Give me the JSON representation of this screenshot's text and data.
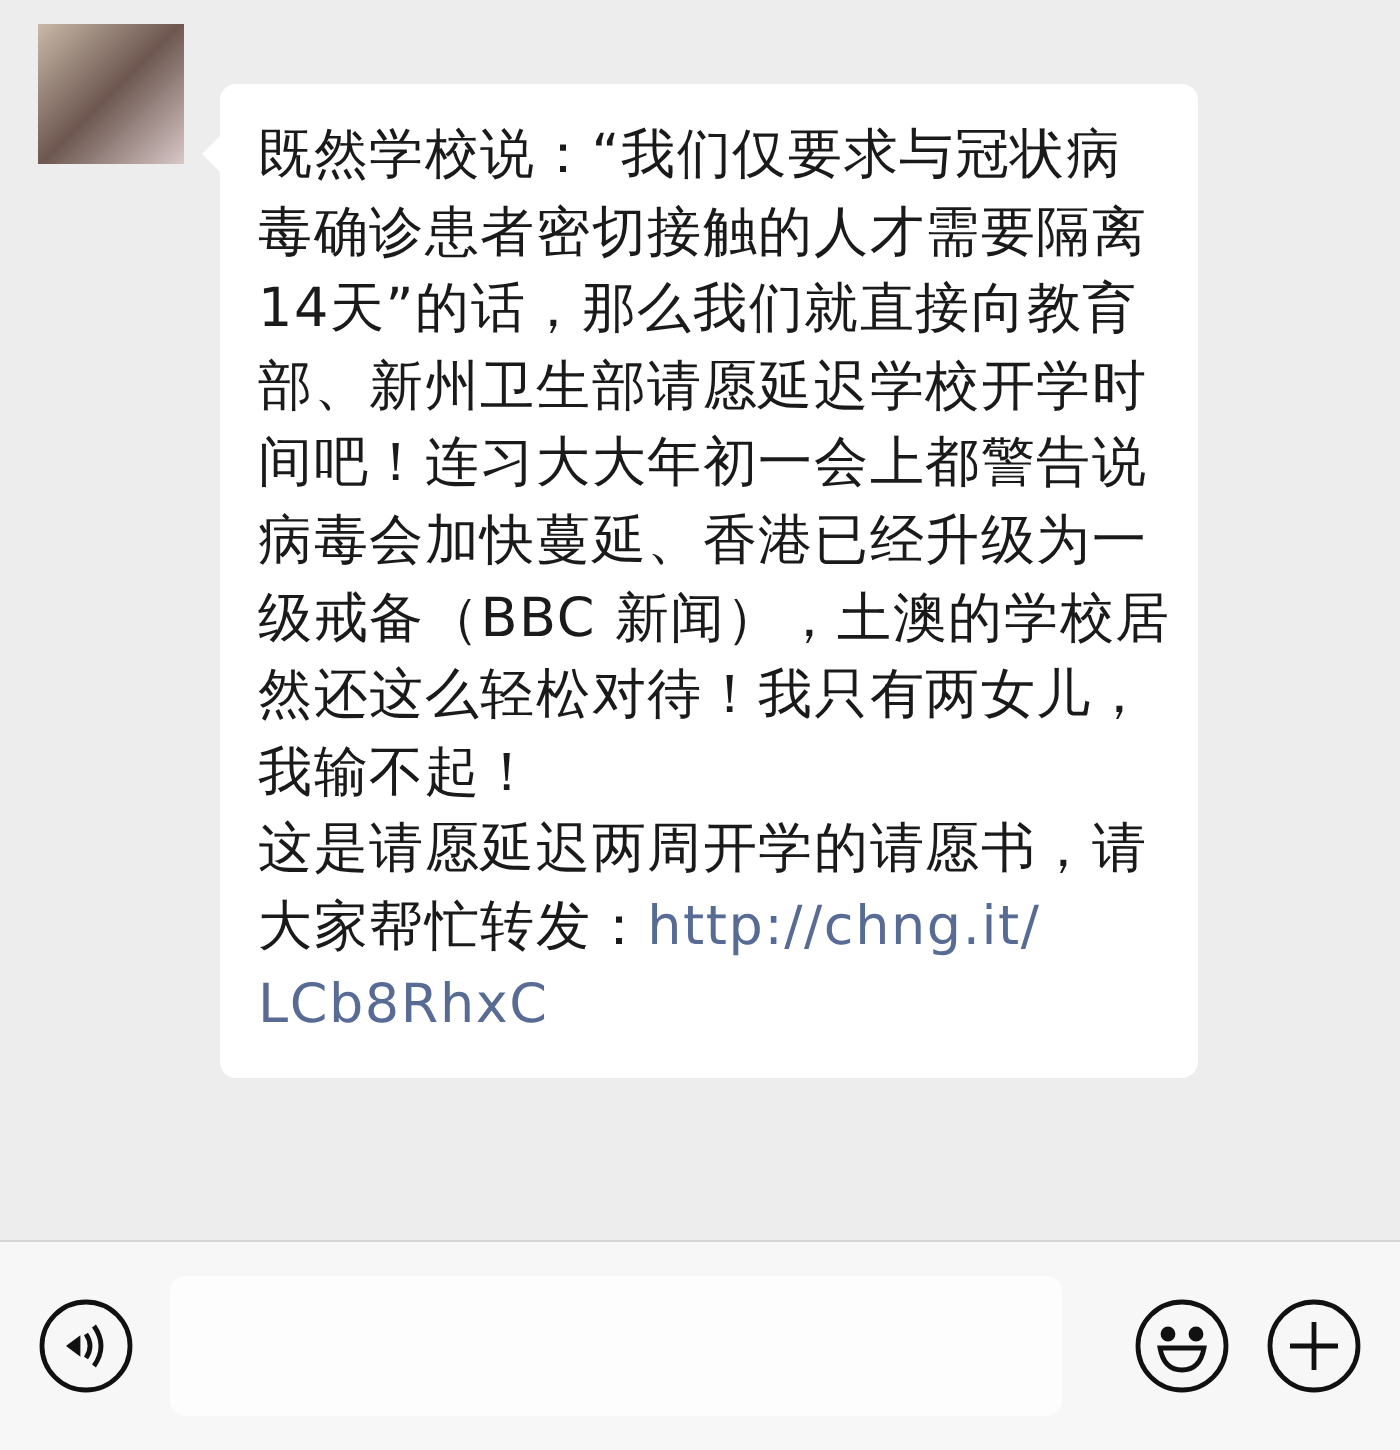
{
  "message": {
    "lines": [
      "既然学校说：“我们仅要求与冠状病",
      "毒确诊患者密切接触的人才需要隔离",
      "14天”的话，那么我们就直接向教育",
      "部、新州卫生部请愿延迟学校开学时",
      "间吧！连习大大年初一会上都警告说",
      "病毒会加快蔓延、香港已经升级为一",
      "级戒备（BBC 新闻），土澳的学校居",
      "然还这么轻松对待！我只有两女儿，",
      "我输不起！",
      "这是请愿延迟两周开学的请愿书，请"
    ],
    "lead": "大家帮忙转发：",
    "link_lines": [
      "http://chng.it/",
      "LCb8RhxC"
    ]
  }
}
